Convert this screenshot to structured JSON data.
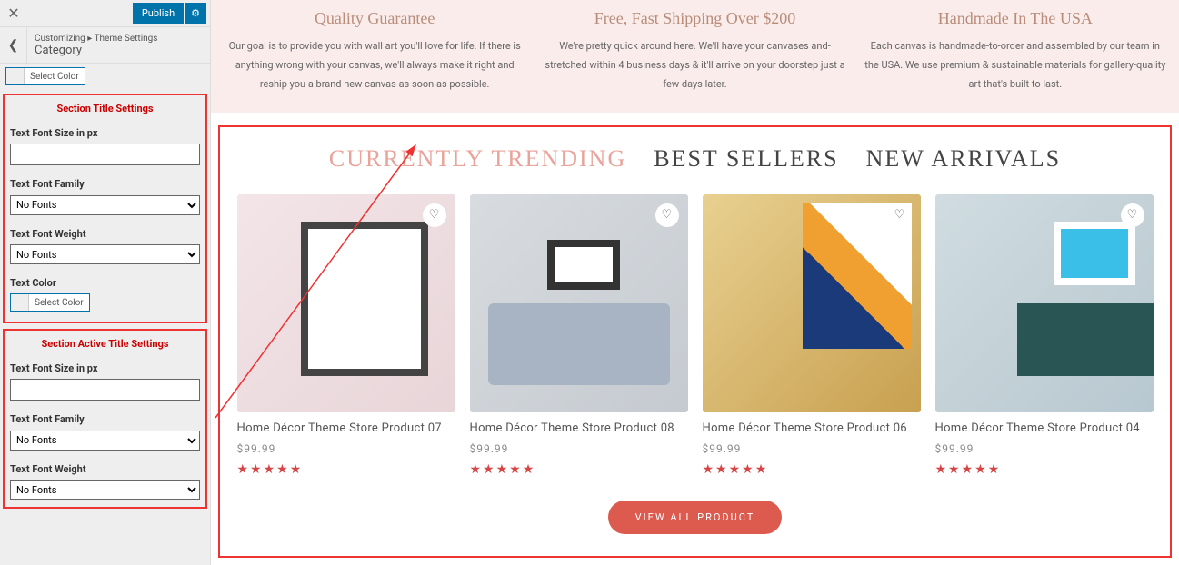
{
  "sidebar": {
    "publish_label": "Publish",
    "breadcrumb": "Customizing ▸ Theme Settings",
    "current": "Category",
    "top_color_btn": "Select Color",
    "panel1": {
      "title": "Section Title Settings",
      "font_size_label": "Text Font Size in px",
      "font_size_value": "",
      "font_family_label": "Text Font Family",
      "font_family_value": "No Fonts",
      "font_weight_label": "Text Font Weight",
      "font_weight_value": "No Fonts",
      "text_color_label": "Text Color",
      "select_color": "Select Color"
    },
    "panel2": {
      "title": "Section Active Title Settings",
      "font_size_label": "Text Font Size in px",
      "font_size_value": "",
      "font_family_label": "Text Font Family",
      "font_family_value": "No Fonts",
      "font_weight_label": "Text Font Weight",
      "font_weight_value": "No Fonts"
    }
  },
  "preview": {
    "features": [
      {
        "title": "Quality Guarantee",
        "text": "Our goal is to provide you with wall art you'll love for life. If there is anything wrong with your canvas, we'll always make it right and reship you a brand new canvas as soon as possible."
      },
      {
        "title": "Free, Fast Shipping Over $200",
        "text": "We're pretty quick around here. We'll have your canvases and-stretched within 4 business days & it'll arrive on your doorstep just a few days later."
      },
      {
        "title": "Handmade In The USA",
        "text": "Each canvas is handmade-to-order and assembled by our team in the USA. We use premium & sustainable materials for gallery-quality art that's built to last."
      }
    ],
    "tabs": {
      "trending": "CURRENTLY TRENDING",
      "best": "BEST SELLERS",
      "new": "NEW ARRIVALS"
    },
    "products": [
      {
        "name": "Home Décor Theme Store Product 07",
        "price": "$99.99"
      },
      {
        "name": "Home Décor Theme Store Product 08",
        "price": "$99.99"
      },
      {
        "name": "Home Décor Theme Store Product 06",
        "price": "$99.99"
      },
      {
        "name": "Home Décor Theme Store Product 04",
        "price": "$99.99"
      }
    ],
    "stars": "★★★★★",
    "view_all": "VIEW ALL PRODUCT"
  }
}
